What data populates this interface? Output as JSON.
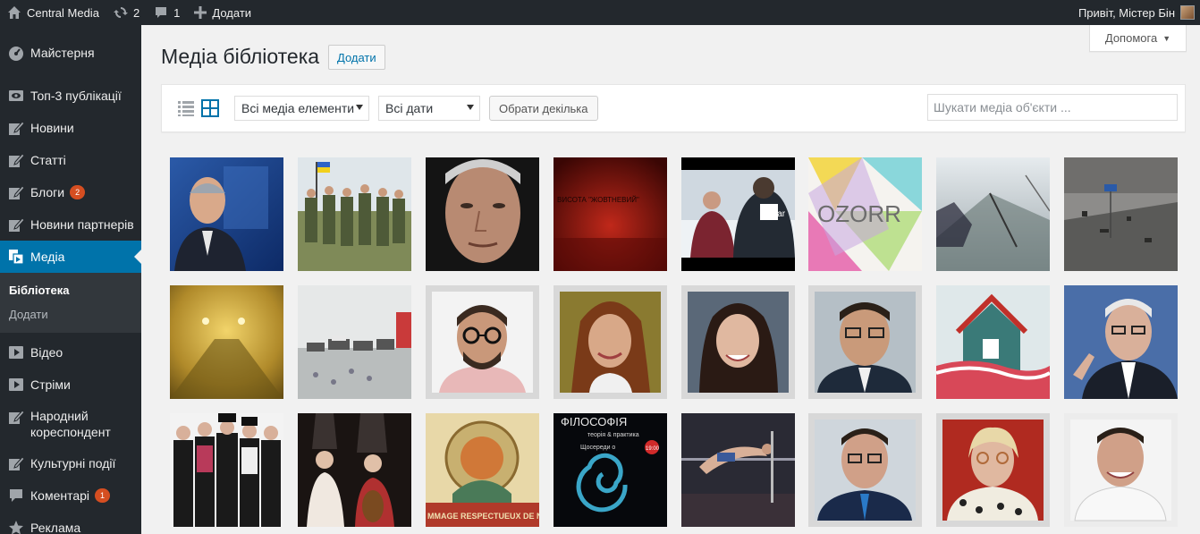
{
  "adminbar": {
    "site_name": "Central Media",
    "updates_count": "2",
    "comments_count": "1",
    "new_label": "Додати",
    "greeting": "Привіт, Містер Бін"
  },
  "sidebar": {
    "items": [
      {
        "label": "Майстерня",
        "icon": "dashboard-icon"
      },
      {
        "label": "Топ-3 публікації",
        "icon": "eye-icon"
      },
      {
        "label": "Новини",
        "icon": "edit-icon"
      },
      {
        "label": "Статті",
        "icon": "edit-icon"
      },
      {
        "label": "Блоги",
        "icon": "edit-icon",
        "badge": "2"
      },
      {
        "label": "Новини партнерів",
        "icon": "edit-icon"
      },
      {
        "label": "Медіа",
        "icon": "media-icon",
        "active": true
      },
      {
        "label": "Відео",
        "icon": "video-icon"
      },
      {
        "label": "Стріми",
        "icon": "video-icon"
      },
      {
        "label": "Народний кореспондент",
        "icon": "edit-icon"
      },
      {
        "label": "Культурні події",
        "icon": "edit-icon"
      },
      {
        "label": "Коментарі",
        "icon": "comment-icon",
        "badge": "1"
      },
      {
        "label": "Реклама",
        "icon": "star-icon"
      }
    ],
    "submenu": {
      "library": "Бібліотека",
      "add": "Додати"
    }
  },
  "help_tab": "Допомога",
  "page": {
    "title": "Медіа бібліотека",
    "add_button": "Додати"
  },
  "toolbar": {
    "filter_type": "Всі медіа елементи",
    "filter_date": "Всі дати",
    "bulk_select": "Обрати декілька",
    "search_placeholder": "Шукати медіа об'єкти ..."
  },
  "media_items": [
    {
      "alt": "portrait-man-suit-blue-background"
    },
    {
      "alt": "soldiers-with-ukrainian-flag"
    },
    {
      "alt": "closeup-man-face"
    },
    {
      "alt": "red-poster-text"
    },
    {
      "alt": "people-in-snow-caritas"
    },
    {
      "alt": "prozorro-logo"
    },
    {
      "alt": "broken-window-sky"
    },
    {
      "alt": "damaged-street-debris"
    },
    {
      "alt": "foggy-tunnel-yellow"
    },
    {
      "alt": "street-traffic-accident"
    },
    {
      "alt": "man-glasses-beard"
    },
    {
      "alt": "woman-smiling-portrait"
    },
    {
      "alt": "woman-dark-hair-portrait"
    },
    {
      "alt": "man-glasses-suit-portrait"
    },
    {
      "alt": "house-roof-scarf"
    },
    {
      "alt": "man-glasses-pointing"
    },
    {
      "alt": "band-five-men-hats"
    },
    {
      "alt": "performers-tall-hats-cello"
    },
    {
      "alt": "art-nouveau-poster"
    },
    {
      "alt": "philosophy-poster-nautilus"
    },
    {
      "alt": "high-jump-athlete"
    },
    {
      "alt": "man-suit-tie-portrait"
    },
    {
      "alt": "woman-blonde-glasses"
    },
    {
      "alt": "man-smiling-white-shirt"
    }
  ],
  "poster_texts": {
    "red_poster": "ВИСОТА \"ЖОВТНЕВИЙ\"",
    "prozorro": "OZORR",
    "caritas": "Car",
    "philosophy_title": "ФІЛОСОФІЯ",
    "philosophy_sub": "теорія & практика",
    "philosophy_when": "Щосереди о",
    "philosophy_time": "19:00",
    "nouveau": "MMAGE RESPECTUEUX DE NESTL"
  }
}
